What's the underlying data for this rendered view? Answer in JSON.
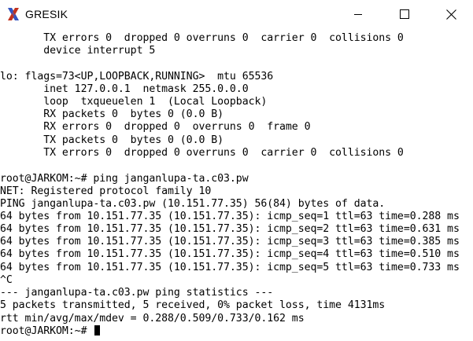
{
  "window": {
    "title": "GRESIK",
    "icon": "x-terminal-icon"
  },
  "controls": {
    "minimize": "minimize-icon",
    "maximize": "maximize-icon",
    "close": "close-icon"
  },
  "terminal": {
    "lines": [
      "       TX errors 0  dropped 0 overruns 0  carrier 0  collisions 0",
      "       device interrupt 5",
      "",
      "lo: flags=73<UP,LOOPBACK,RUNNING>  mtu 65536",
      "       inet 127.0.0.1  netmask 255.0.0.0",
      "       loop  txqueuelen 1  (Local Loopback)",
      "       RX packets 0  bytes 0 (0.0 B)",
      "       RX errors 0  dropped 0  overruns 0  frame 0",
      "       TX packets 0  bytes 0 (0.0 B)",
      "       TX errors 0  dropped 0 overruns 0  carrier 0  collisions 0",
      "",
      "root@JARKOM:~# ping janganlupa-ta.c03.pw",
      "NET: Registered protocol family 10",
      "PING janganlupa-ta.c03.pw (10.151.77.35) 56(84) bytes of data.",
      "64 bytes from 10.151.77.35 (10.151.77.35): icmp_seq=1 ttl=63 time=0.288 ms",
      "64 bytes from 10.151.77.35 (10.151.77.35): icmp_seq=2 ttl=63 time=0.631 ms",
      "64 bytes from 10.151.77.35 (10.151.77.35): icmp_seq=3 ttl=63 time=0.385 ms",
      "64 bytes from 10.151.77.35 (10.151.77.35): icmp_seq=4 ttl=63 time=0.510 ms",
      "64 bytes from 10.151.77.35 (10.151.77.35): icmp_seq=5 ttl=63 time=0.733 ms",
      "^C",
      "--- janganlupa-ta.c03.pw ping statistics ---",
      "5 packets transmitted, 5 received, 0% packet loss, time 4131ms",
      "rtt min/avg/max/mdev = 0.288/0.509/0.733/0.162 ms"
    ],
    "prompt": "root@JARKOM:~# "
  },
  "colors": {
    "background": "#ffffff",
    "text": "#000000",
    "icon_x": "#1f3fa8"
  }
}
